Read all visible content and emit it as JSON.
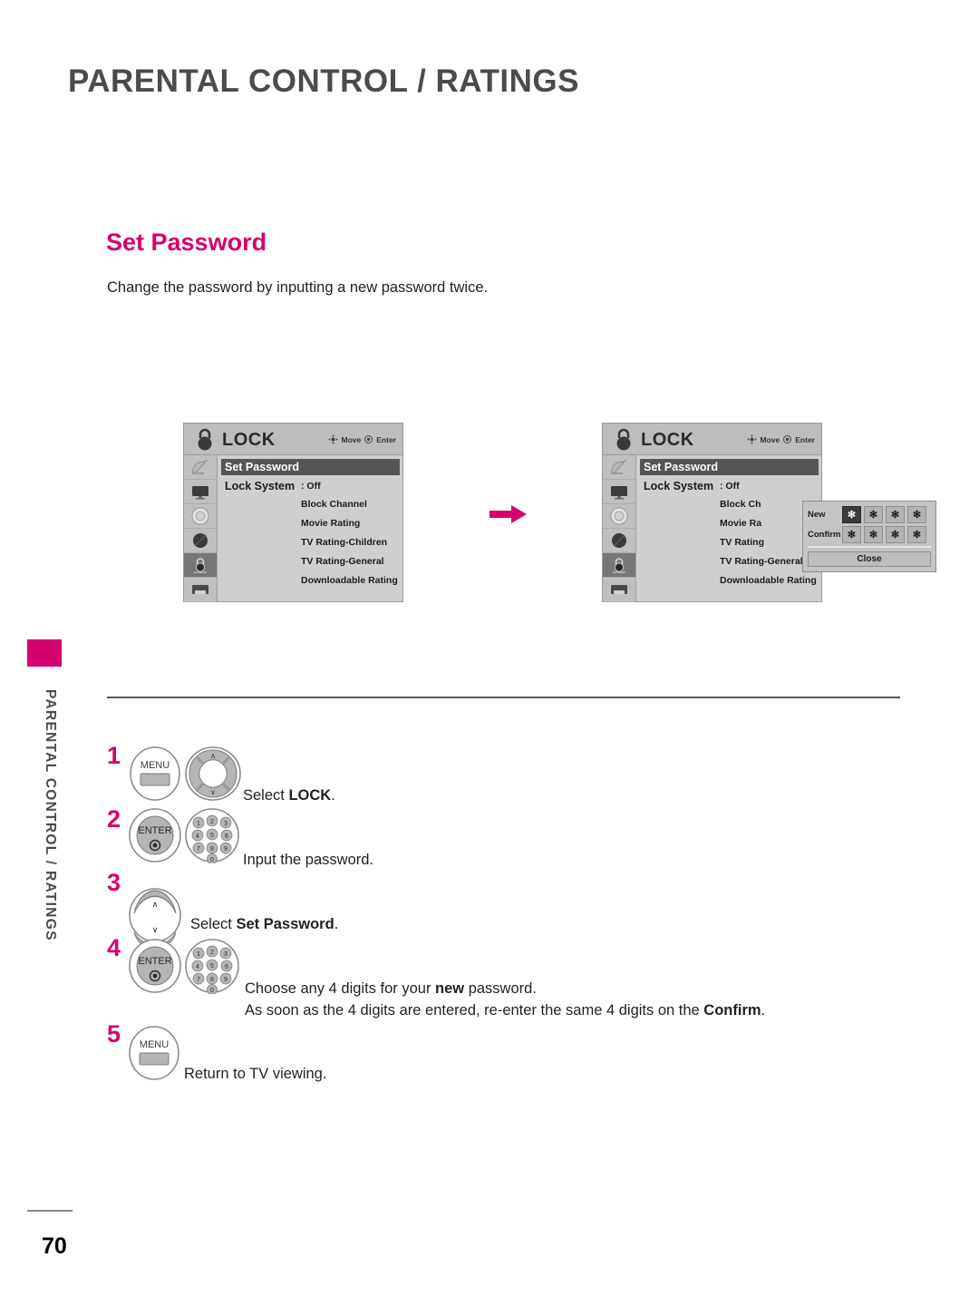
{
  "page": {
    "title": "PARENTAL CONTROL / RATINGS",
    "number": "70",
    "side_tab_label": "PARENTAL CONTROL / RATINGS"
  },
  "section": {
    "heading": "Set Password",
    "description": "Change the password by inputting a new password twice.",
    "accent_color": "#d6006e"
  },
  "osd_left": {
    "title": "LOCK",
    "hint_move": "Move",
    "hint_enter": "Enter",
    "highlight_item": "Set Password",
    "lock_system_label": "Lock System",
    "sub_items": [
      ": Off",
      "Block Channel",
      "Movie Rating",
      "TV Rating-Children",
      "TV Rating-General",
      "Downloadable Rating"
    ],
    "sidebar_icons": [
      "satellite-dish-icon",
      "tv-icon",
      "dial-icon",
      "circle-icon",
      "lock-icon",
      "screen-icon"
    ],
    "selected_sidebar_index": 4
  },
  "osd_right": {
    "title": "LOCK",
    "hint_move": "Move",
    "hint_enter": "Enter",
    "highlight_item": "Set Password",
    "lock_system_label": "Lock System",
    "sub_items": [
      ": Off",
      "Block Ch",
      "Movie Ra",
      "TV Rating",
      "TV Rating-General",
      "Downloadable Rating"
    ],
    "dialog": {
      "new_label": "New",
      "confirm_label": "Confirm",
      "mask_char": "✻",
      "new_boxes": [
        "✻",
        "✻",
        "✻",
        "✻"
      ],
      "confirm_boxes": [
        "✻",
        "✻",
        "✻",
        "✻"
      ],
      "active_box_index": 0,
      "close_label": "Close"
    }
  },
  "steps": [
    {
      "number": "1",
      "icons": [
        "menu-button-icon",
        "dpad-button-icon"
      ],
      "text_pre": "Select ",
      "text_bold": "LOCK",
      "text_post": "."
    },
    {
      "number": "2",
      "icons": [
        "enter-button-icon",
        "number-keypad-icon"
      ],
      "text_pre": "Input the password.",
      "text_bold": "",
      "text_post": ""
    },
    {
      "number": "3",
      "icons": [
        "updown-button-icon"
      ],
      "text_pre": "Select ",
      "text_bold": "Set Password",
      "text_post": "."
    },
    {
      "number": "4",
      "icons": [
        "enter-button-icon",
        "number-keypad-icon"
      ],
      "line1_pre": "Choose any 4 digits for your ",
      "line1_bold": "new",
      "line1_post": " password.",
      "line2_pre": "As soon as the 4 digits are entered, re-enter the same 4 digits on the ",
      "line2_bold": "Confirm",
      "line2_post": "."
    },
    {
      "number": "5",
      "icons": [
        "menu-button-icon"
      ],
      "text_pre": "Return to TV viewing.",
      "text_bold": "",
      "text_post": ""
    }
  ],
  "button_labels": {
    "menu": "MENU",
    "enter": "ENTER",
    "keypad_digits": [
      "1",
      "2",
      "3",
      "4",
      "5",
      "6",
      "7",
      "8",
      "9",
      "0"
    ]
  }
}
